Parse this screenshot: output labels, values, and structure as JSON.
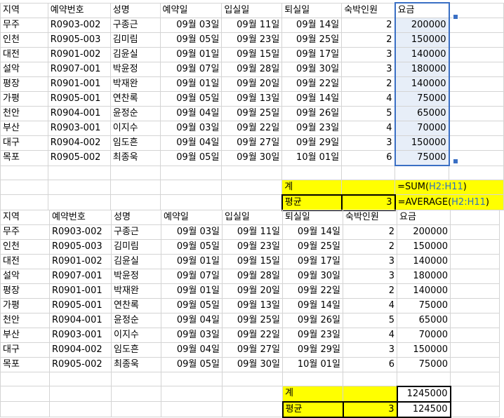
{
  "headers": [
    "지역",
    "예약번호",
    "성명",
    "예약일",
    "입실일",
    "퇴실일",
    "숙박인원",
    "요금"
  ],
  "rows": [
    {
      "region": "무주",
      "id": "R0903-002",
      "name": "구종근",
      "reserve": "09월 03일",
      "checkin": "09월 11일",
      "checkout": "09월 14일",
      "people": "2",
      "fee": "200000"
    },
    {
      "region": "인천",
      "id": "R0905-003",
      "name": "김미림",
      "reserve": "09월 05일",
      "checkin": "09월 23일",
      "checkout": "09월 25일",
      "people": "2",
      "fee": "150000"
    },
    {
      "region": "대전",
      "id": "R0901-002",
      "name": "김윤실",
      "reserve": "09월 01일",
      "checkin": "09월 15일",
      "checkout": "09월 17일",
      "people": "3",
      "fee": "140000"
    },
    {
      "region": "설악",
      "id": "R0907-001",
      "name": "박윤정",
      "reserve": "09월 07일",
      "checkin": "09월 28일",
      "checkout": "09월 30일",
      "people": "3",
      "fee": "180000"
    },
    {
      "region": "평장",
      "id": "R0901-001",
      "name": "박재완",
      "reserve": "09월 01일",
      "checkin": "09월 20일",
      "checkout": "09월 22일",
      "people": "2",
      "fee": "140000"
    },
    {
      "region": "가평",
      "id": "R0905-001",
      "name": "연찬록",
      "reserve": "09월 05일",
      "checkin": "09월 13일",
      "checkout": "09월 14일",
      "people": "4",
      "fee": "75000"
    },
    {
      "region": "천안",
      "id": "R0904-001",
      "name": "윤정순",
      "reserve": "09월 04일",
      "checkin": "09월 25일",
      "checkout": "09월 26일",
      "people": "5",
      "fee": "65000"
    },
    {
      "region": "부산",
      "id": "R0903-001",
      "name": "이지수",
      "reserve": "09월 03일",
      "checkin": "09월 22일",
      "checkout": "09월 23일",
      "people": "4",
      "fee": "70000"
    },
    {
      "region": "대구",
      "id": "R0904-002",
      "name": "임도흔",
      "reserve": "09월 04일",
      "checkin": "09월 27일",
      "checkout": "09월 29일",
      "people": "3",
      "fee": "150000"
    },
    {
      "region": "목포",
      "id": "R0905-002",
      "name": "최종욱",
      "reserve": "09월 05일",
      "checkin": "09월 30일",
      "checkout": "10월 01일",
      "people": "6",
      "fee": "75000"
    }
  ],
  "summary_top": {
    "sum_label": "계",
    "avg_label": "평균",
    "avg_people": "3",
    "sum_formula_prefix": "=SUM(",
    "sum_formula_ref": "H2:H11",
    "sum_formula_suffix": ")",
    "avg_formula_prefix": "=AVERAGE(",
    "avg_formula_ref": "H2:H11",
    "avg_formula_suffix": ")"
  },
  "summary_bottom": {
    "sum_label": "계",
    "avg_label": "평균",
    "avg_people": "3",
    "sum_value": "1245000",
    "avg_value": "124500"
  },
  "colors": {
    "highlight": "#ffff00",
    "selection": "#3a6fc4",
    "reference": "#2f6fc1"
  }
}
